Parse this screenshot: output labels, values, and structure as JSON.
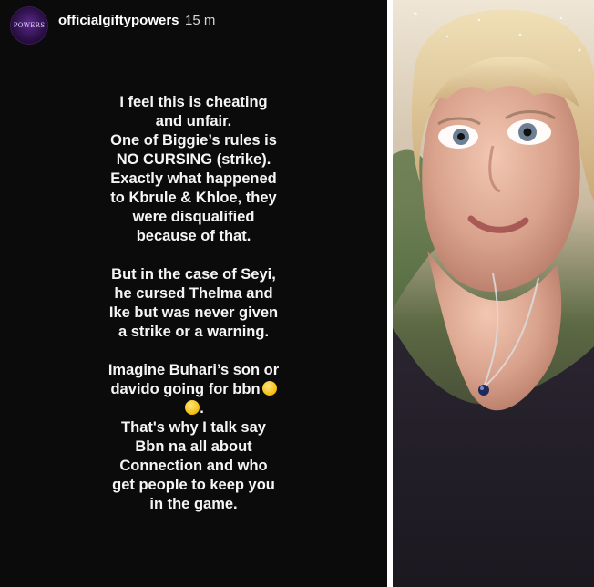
{
  "story": {
    "avatar_text": "POWERS",
    "username": "officialgiftypowers",
    "timestamp": "15 m",
    "paragraphs": [
      {
        "lines": [
          "I feel this is cheating",
          "and unfair.",
          "One of Biggie’s rules is",
          "NO CURSING (strike).",
          "Exactly what happened",
          "to Kbrule & Khloe, they",
          "were disqualified",
          "because of that."
        ]
      },
      {
        "lines": [
          "But in the case of Seyi,",
          "he cursed Thelma and",
          "Ike but was never given",
          "a strike or a warning."
        ]
      },
      {
        "lines": [
          "Imagine Buhari’s son or",
          "davido going for bbn",
          "",
          "That's why I talk say",
          "Bbn na all about",
          "Connection and who",
          "get people to keep you",
          "in the game."
        ],
        "emoji_icon": "rolling-on-the-floor-laughing-emoji"
      }
    ]
  },
  "colors": {
    "story_background": "#0b0b0b",
    "text": "#f5f5f5",
    "avatar": "#2a0f45"
  }
}
